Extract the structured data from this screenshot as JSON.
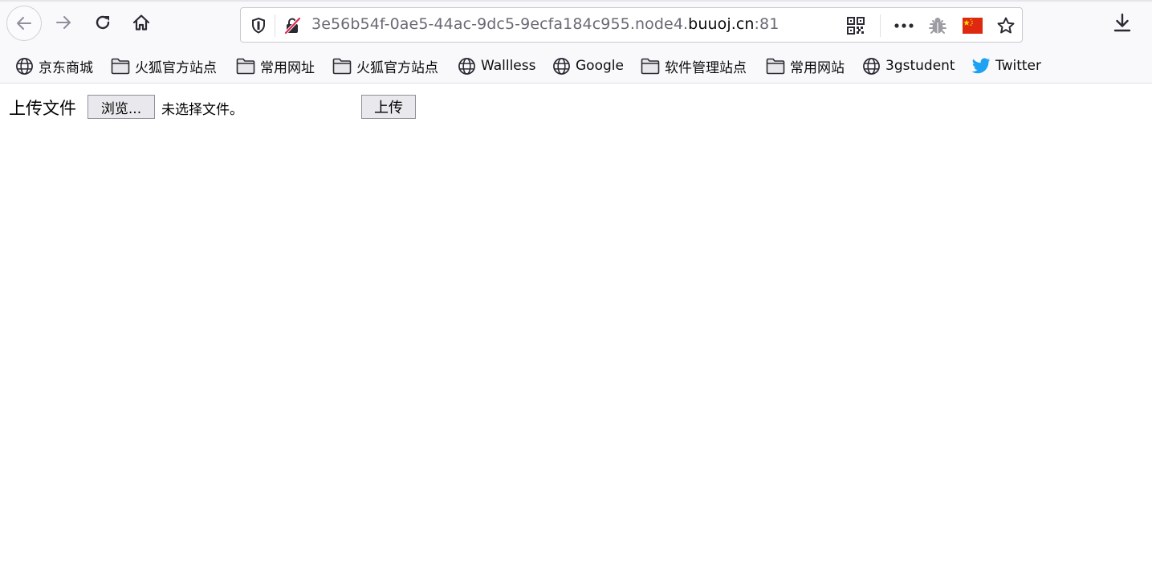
{
  "colors": {
    "toolbar_bg": "#f9f9fb",
    "icon": "#2b2a33",
    "icon_muted": "#8f8f9d",
    "url_muted": "#6a6a75",
    "insecure_red": "#e22850",
    "twitter_blue": "#1da1f2",
    "flag_red": "#de2910",
    "flag_star": "#ffde00"
  },
  "toolbar": {
    "back_icon": "arrow-left-icon",
    "forward_icon": "arrow-right-icon",
    "reload_icon": "reload-icon",
    "home_icon": "home-icon",
    "download_icon": "download-icon"
  },
  "urlbar": {
    "url_prefix": "3e56b54f-0ae5-44ac-9dc5-9ecfa184c955.node4.",
    "url_host": "buuoj.cn",
    "url_suffix": ":81",
    "icons": [
      "shield-icon",
      "insecure-lock-icon",
      "qr-code-icon",
      "more-icon",
      "bug-icon",
      "china-flag-icon",
      "bookmark-star-icon"
    ]
  },
  "bookmarks": [
    {
      "label": "京东商城",
      "icon": "globe-icon"
    },
    {
      "label": "火狐官方站点",
      "icon": "folder-icon"
    },
    {
      "label": "常用网址",
      "icon": "folder-icon"
    },
    {
      "label": "火狐官方站点",
      "icon": "folder-icon"
    },
    {
      "label": "Wallless",
      "icon": "globe-icon"
    },
    {
      "label": "Google",
      "icon": "globe-icon"
    },
    {
      "label": "软件管理站点",
      "icon": "folder-icon"
    },
    {
      "label": "常用网站",
      "icon": "folder-icon"
    },
    {
      "label": "3gstudent",
      "icon": "globe-icon"
    },
    {
      "label": "Twitter",
      "icon": "twitter-icon"
    }
  ],
  "form": {
    "label": "上传文件",
    "browse_button": "浏览...",
    "no_file_text": "未选择文件。",
    "submit_button": "上传"
  }
}
